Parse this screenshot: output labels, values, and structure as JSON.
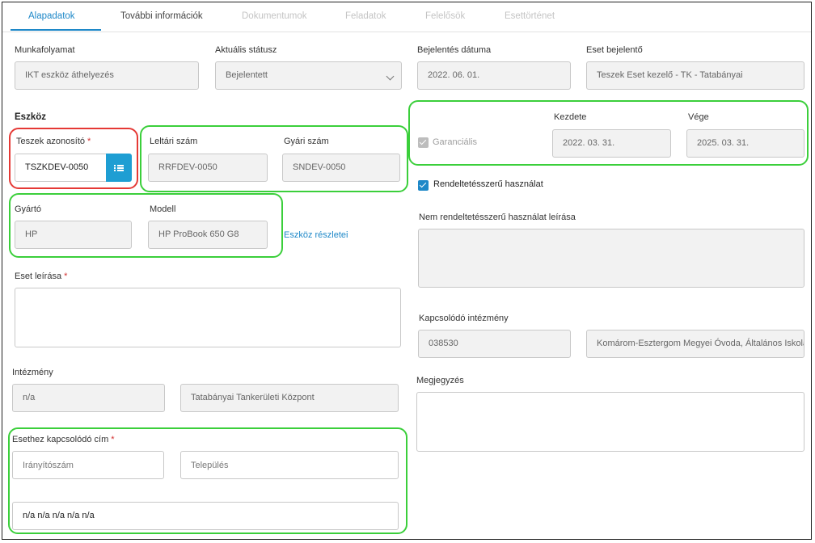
{
  "tabs": [
    {
      "label": "Alapadatok",
      "state": "active"
    },
    {
      "label": "További információk",
      "state": "enabled"
    },
    {
      "label": "Dokumentumok",
      "state": "disabled"
    },
    {
      "label": "Feladatok",
      "state": "disabled"
    },
    {
      "label": "Felelősök",
      "state": "disabled"
    },
    {
      "label": "Esettörténet",
      "state": "disabled"
    }
  ],
  "workflow": {
    "label": "Munkafolyamat",
    "value": "IKT eszköz áthelyezés"
  },
  "status": {
    "label": "Aktuális státusz",
    "value": "Bejelentett"
  },
  "report_date": {
    "label": "Bejelentés dátuma",
    "value": "2022. 06. 01."
  },
  "reporter": {
    "label": "Eset bejelentő",
    "value": "Teszek Eset kezelő - TK - Tatabányai"
  },
  "device_section": "Eszköz",
  "device_id": {
    "label": "Teszek azonosító",
    "required_mark": "*",
    "value": "TSZKDEV-0050"
  },
  "inventory_no": {
    "label": "Leltári szám",
    "value": "RRFDEV-0050"
  },
  "serial_no": {
    "label": "Gyári szám",
    "value": "SNDEV-0050"
  },
  "manufacturer": {
    "label": "Gyártó",
    "value": "HP"
  },
  "model": {
    "label": "Modell",
    "value": "HP ProBook 650 G8"
  },
  "device_details_link": "Eszköz részletei",
  "warranty": {
    "label": "Garanciális",
    "checked": true,
    "disabled": true
  },
  "warranty_start": {
    "label": "Kezdete",
    "value": "2022. 03. 31."
  },
  "warranty_end": {
    "label": "Vége",
    "value": "2025. 03. 31."
  },
  "intended_use": {
    "label": "Rendeltetésszerű használat",
    "checked": true
  },
  "non_intended_desc": {
    "label": "Nem rendeltetésszerű használat leírása",
    "value": ""
  },
  "case_desc": {
    "label": "Eset leírása",
    "required_mark": "*",
    "value": ""
  },
  "related_institution": {
    "label": "Kapcsolódó intézmény",
    "code": "038530",
    "name": "Komárom-Esztergom Megyei Óvoda, Általános Iskola"
  },
  "institution": {
    "label": "Intézmény",
    "code": "n/a",
    "name": "Tatabányai Tankerületi Központ"
  },
  "note": {
    "label": "Megjegyzés",
    "value": ""
  },
  "address": {
    "label": "Esethez kapcsolódó cím",
    "required_mark": "*",
    "zip_placeholder": "Irányítószám",
    "city_placeholder": "Település",
    "full": "n/a n/a n/a n/a n/a"
  },
  "colors": {
    "accent": "#1e88c8",
    "highlight_green": "#3bcf3b",
    "highlight_red": "#e53935",
    "required": "#d32f2f"
  },
  "icons": {
    "device_picker": "list-icon",
    "status_dropdown": "chevron-down-icon",
    "checkbox": "check-icon"
  }
}
